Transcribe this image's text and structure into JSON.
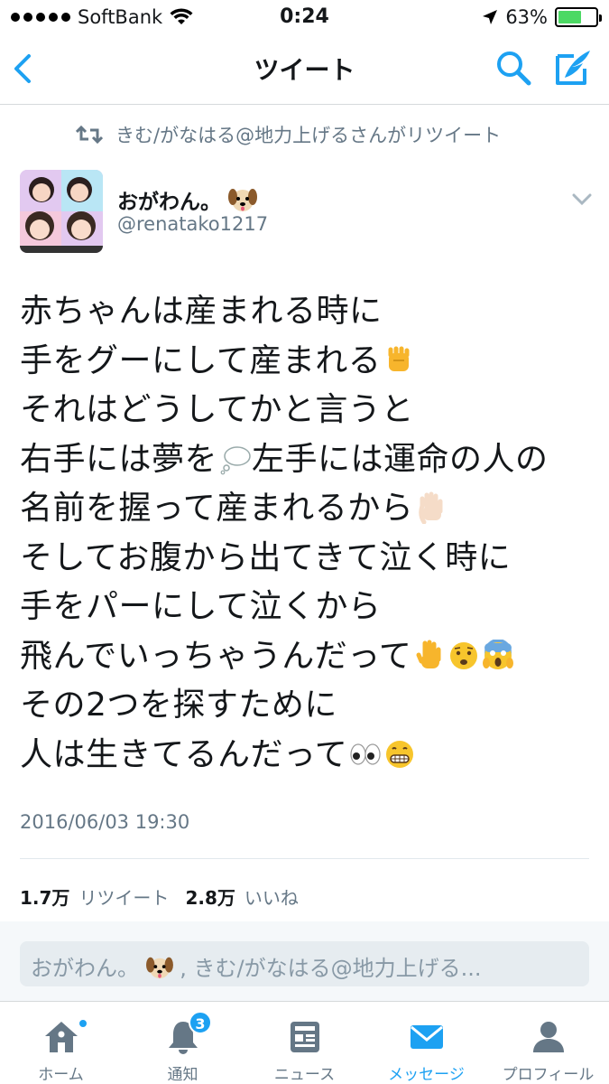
{
  "status_bar": {
    "carrier": "SoftBank",
    "time": "0:24",
    "battery_percent_text": "63%",
    "battery_level": 0.63,
    "signal_bars": 5
  },
  "nav": {
    "title": "ツイート",
    "back_icon": "chevron-left-icon",
    "search_icon": "search-icon",
    "compose_icon": "compose-tweet-icon"
  },
  "retweet_context": {
    "text": "きむ/がなはる@地力上げるさんがリツイート",
    "icon": "retweet-icon"
  },
  "author": {
    "name": "おがわん。",
    "name_emoji": "dog-face-emoji",
    "handle": "@renatako1217"
  },
  "tweet": {
    "lines": [
      {
        "text": "赤ちゃんは産まれる時に",
        "emojis": []
      },
      {
        "text": "手をグーにして産まれる",
        "emojis": [
          "raised-fist-emoji"
        ]
      },
      {
        "text": "それはどうしてかと言うと",
        "emojis": []
      },
      {
        "text": "右手には夢を",
        "emojis": [
          "thought-balloon-emoji"
        ],
        "tail": "左手には運命の人の"
      },
      {
        "text": "名前を握って産まれるから",
        "emojis": [
          "raised-hand-emoji-light"
        ]
      },
      {
        "text": "そしてお腹から出てきて泣く時に",
        "emojis": []
      },
      {
        "text": "手をパーにして泣くから",
        "emojis": []
      },
      {
        "text": "飛んでいっちゃうんだって",
        "emojis": [
          "raised-hand-emoji",
          "anguished-face-emoji",
          "screaming-face-emoji"
        ]
      },
      {
        "text": "その2つを探すために",
        "emojis": []
      },
      {
        "text": "人は生きてるんだって",
        "emojis": [
          "eyes-emoji",
          "grinning-teeth-emoji"
        ]
      }
    ],
    "timestamp": "2016/06/03 19:30",
    "retweet_count": "1.7万",
    "retweet_label": "リツイート",
    "like_count": "2.8万",
    "like_label": "いいね"
  },
  "reply": {
    "prefix": "おがわん。",
    "suffix": ", きむ/がなはる@地力上げる..."
  },
  "tabbar": {
    "tabs": [
      {
        "label": "ホーム",
        "icon": "home-icon",
        "active": false,
        "has_dot": true
      },
      {
        "label": "通知",
        "icon": "bell-icon",
        "active": false,
        "badge": "3"
      },
      {
        "label": "ニュース",
        "icon": "news-icon",
        "active": false
      },
      {
        "label": "メッセージ",
        "icon": "envelope-icon",
        "active": true
      },
      {
        "label": "プロフィール",
        "icon": "person-icon",
        "active": false
      }
    ]
  },
  "colors": {
    "accent": "#1da1f2",
    "secondary_text": "#657786",
    "battery_fill": "#4cd964"
  }
}
